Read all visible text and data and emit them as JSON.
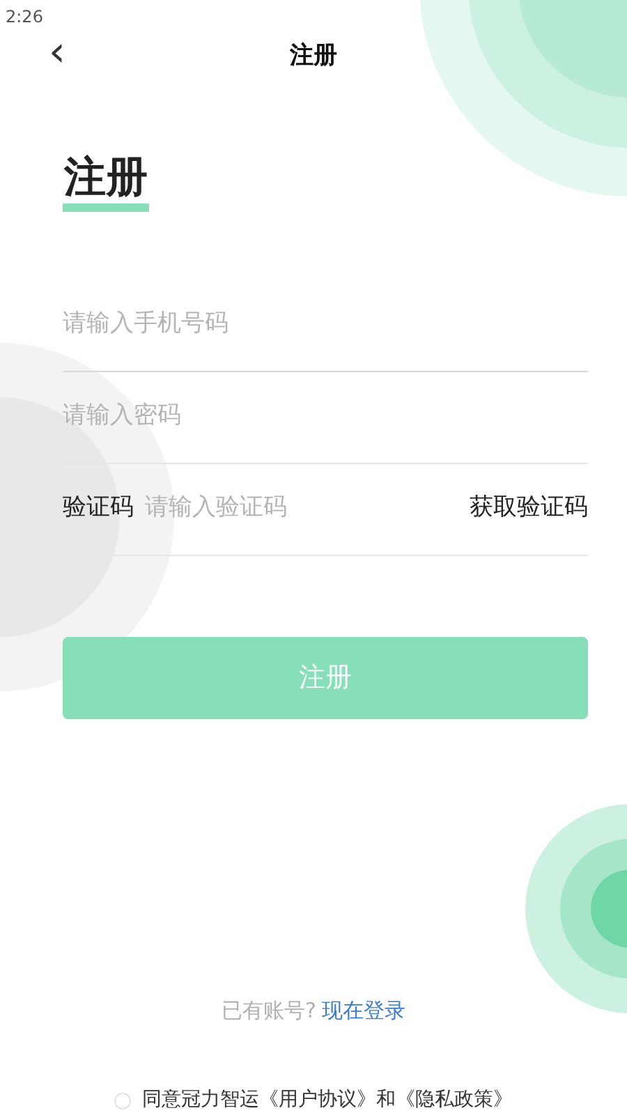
{
  "status_bar": {
    "time": "2:26"
  },
  "header": {
    "back": "‹",
    "title": "注册"
  },
  "heading": "注册",
  "fields": [
    {
      "kind": "plain",
      "placeholder": "请输入手机号码"
    },
    {
      "kind": "plain",
      "placeholder": "请输入密码"
    },
    {
      "kind": "code",
      "label": "验证码",
      "placeholder": "请输入验证码",
      "action": "获取验证码"
    }
  ],
  "submit": {
    "label": "注册",
    "disabled": true
  },
  "login_prompt": {
    "text": "已有账号?",
    "link": "现在登录"
  },
  "agreement": {
    "checked": false,
    "text": "同意冠力智运《用户协议》和《隐私政策》"
  }
}
